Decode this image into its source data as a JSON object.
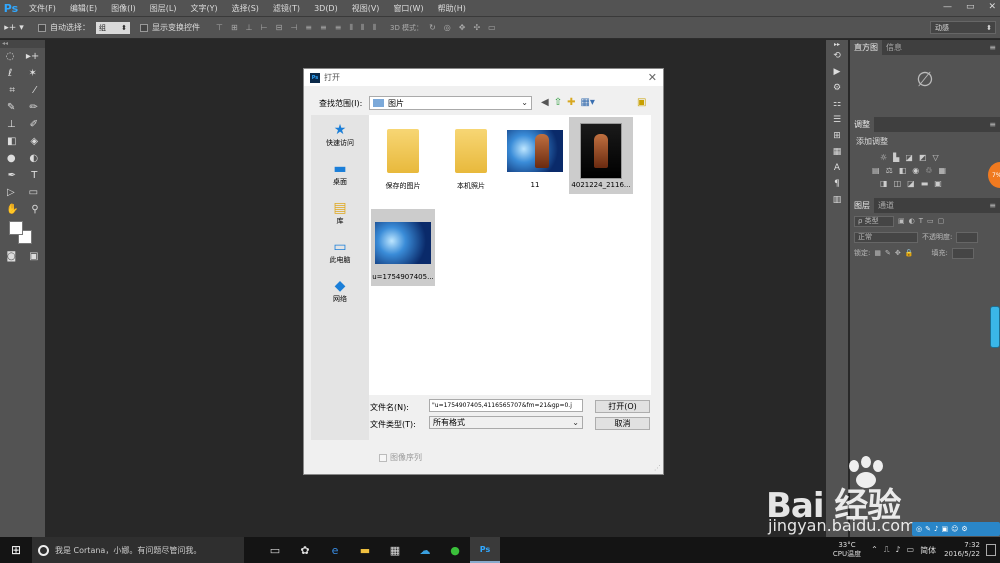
{
  "app": {
    "logo": "Ps",
    "menu": [
      "文件(F)",
      "编辑(E)",
      "图像(I)",
      "图层(L)",
      "文字(Y)",
      "选择(S)",
      "滤镜(T)",
      "3D(D)",
      "视图(V)",
      "窗口(W)",
      "帮助(H)"
    ],
    "window_controls": [
      "—",
      "▭",
      "✕"
    ]
  },
  "options_bar": {
    "tool_icon": "move-tool-icon",
    "auto_select_label": "自动选择：",
    "auto_select_value": "组",
    "show_transform_label": "显示变换控件",
    "mode3d_label": "3D 模式：",
    "workspace": "动感"
  },
  "panels": {
    "history_tabs": [
      "直方图",
      "信息"
    ],
    "adjust_tab": "调整",
    "adjust_hint": "添加调整",
    "layers_tabs": [
      "图层",
      "通道"
    ],
    "kind_label": "ρ 类型",
    "blend_mode": "正常",
    "opacity_label": "不透明度:",
    "lock_label": "锁定:",
    "fill_label": "填充:"
  },
  "dialog": {
    "title": "打开",
    "look_in_label": "查找范围(I):",
    "look_in_value": "图片",
    "places": [
      {
        "label": "快速访问",
        "icon": "star-icon"
      },
      {
        "label": "桌面",
        "icon": "desktop-icon"
      },
      {
        "label": "库",
        "icon": "library-icon"
      },
      {
        "label": "此电脑",
        "icon": "computer-icon"
      },
      {
        "label": "网络",
        "icon": "network-icon"
      }
    ],
    "files": [
      {
        "label": "保存的图片",
        "kind": "folder"
      },
      {
        "label": "本机照片",
        "kind": "folder"
      },
      {
        "label": "11",
        "kind": "image-warrior-blue"
      },
      {
        "label": "4021224_2116...",
        "kind": "image-warrior-dark"
      },
      {
        "label": "u=1754907405...",
        "kind": "image-blue"
      }
    ],
    "selected_file": "u=1754907405...",
    "filename_label": "文件名(N):",
    "filename_value": "\"u=1754907405,4116565707&fm=21&gp=0.j",
    "filetype_label": "文件类型(T):",
    "filetype_value": "所有格式",
    "open_button": "打开(O)",
    "cancel_button": "取消",
    "image_sequence_label": "图像序列"
  },
  "taskbar": {
    "cortana_text": "我是 Cortana，小娜。有问题尽管问我。",
    "weather_temp": "33°C",
    "weather_label": "CPU温度",
    "ime": "简体",
    "time": "7:32",
    "date": "2016/5/22"
  },
  "watermark": {
    "brand": "Bai 经验",
    "url": "jingyan.baidu.com"
  }
}
